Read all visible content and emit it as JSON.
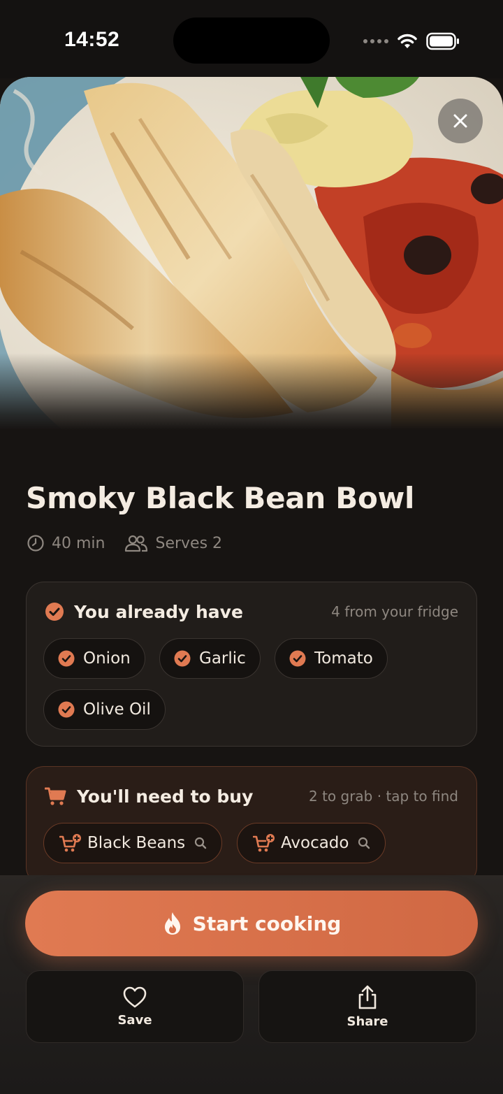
{
  "status_bar": {
    "time": "14:52"
  },
  "recipe": {
    "title": "Smoky Black Bean Bowl",
    "time": "40 min",
    "serves": "Serves 2"
  },
  "have_section": {
    "title": "You already have",
    "subtitle": "4 from your fridge",
    "items": [
      "Onion",
      "Garlic",
      "Tomato",
      "Olive Oil"
    ]
  },
  "buy_section": {
    "title": "You'll need to buy",
    "subtitle": "2 to grab · tap to find",
    "items": [
      "Black Beans",
      "Avocado"
    ]
  },
  "actions": {
    "start_label": "Start cooking",
    "save_label": "Save",
    "share_label": "Share"
  },
  "colors": {
    "accent": "#E07A52",
    "background": "#171412",
    "card": "#211D1A",
    "buy_card": "#2A1D17"
  },
  "icons": {
    "close": "close-icon",
    "clock": "clock-icon",
    "people": "people-icon",
    "check": "check-circle-icon",
    "cart": "cart-icon",
    "cart_add": "cart-plus-icon",
    "search": "search-icon",
    "flame": "flame-icon",
    "heart": "heart-icon",
    "share": "share-icon"
  }
}
